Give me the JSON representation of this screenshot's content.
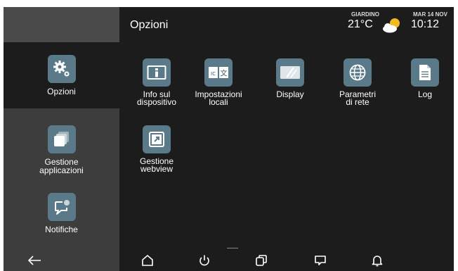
{
  "sidebar": {
    "items": [
      {
        "label": "Opzioni",
        "icon": "gears-icon",
        "active": true
      },
      {
        "label": "Gestione\napplicazioni",
        "icon": "app-stack-icon",
        "active": false
      },
      {
        "label": "Notifiche",
        "icon": "notification-chat-icon",
        "active": false
      }
    ]
  },
  "header": {
    "title": "Opzioni",
    "weather": {
      "location": "GIARDINO",
      "temperature": "21°C",
      "icon": "partly-cloudy-icon"
    },
    "datetime": {
      "date": "MAR 14 NOV",
      "time": "10:12"
    }
  },
  "main": {
    "tiles": [
      {
        "label": "Info sul\ndispositivo",
        "icon": "info-icon"
      },
      {
        "label": "Impostazioni\nlocali",
        "icon": "language-icon"
      },
      {
        "label": "Display",
        "icon": "display-icon"
      },
      {
        "label": "Parametri\ndi rete",
        "icon": "globe-icon"
      },
      {
        "label": "Log",
        "icon": "document-icon"
      },
      {
        "label": "Gestione\nwebview",
        "icon": "external-link-icon"
      }
    ],
    "language_icon_glyphs": {
      "left": "IC",
      "right": "文"
    }
  },
  "navbar": {
    "buttons": [
      "back-icon",
      "home-icon",
      "power-icon",
      "recent-apps-icon",
      "chat-icon",
      "bell-icon"
    ]
  },
  "colors": {
    "accent": "#5a7a8a",
    "background": "#1c1c1c",
    "sidebar": "#3d3d3d"
  }
}
